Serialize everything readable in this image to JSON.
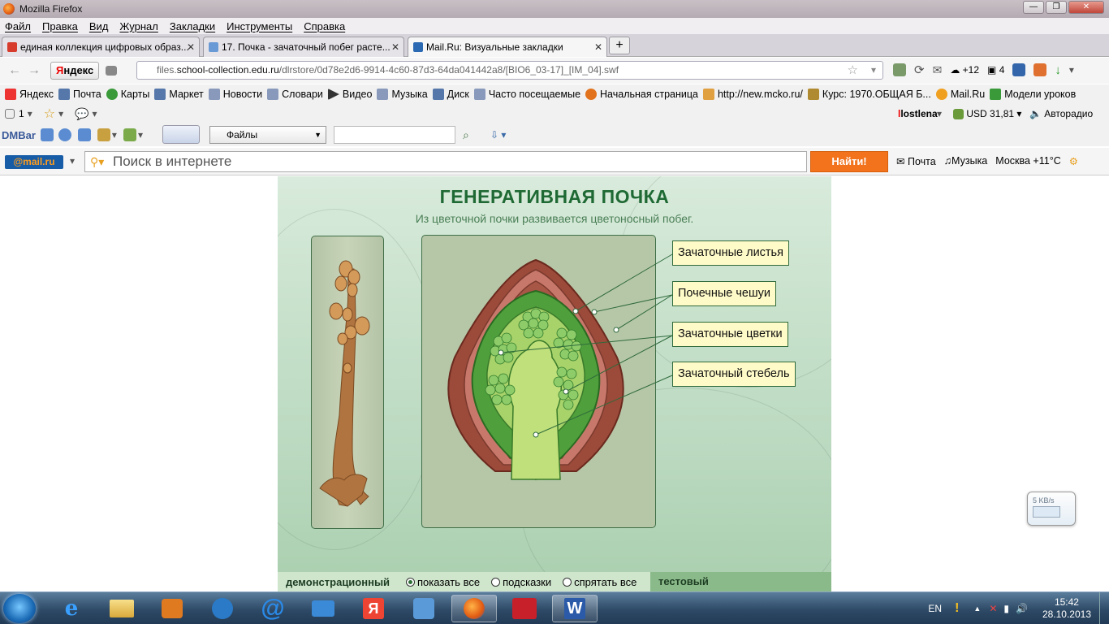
{
  "window": {
    "title": "Mozilla Firefox",
    "buttons": [
      "—",
      "❐",
      "✕"
    ]
  },
  "menu": [
    "Файл",
    "Правка",
    "Вид",
    "Журнал",
    "Закладки",
    "Инструменты",
    "Справка"
  ],
  "tabs": [
    {
      "label": "единая коллекция цифровых образ...",
      "fav_color": "#d63b2b"
    },
    {
      "label": "17. Почка - зачаточный побег расте...",
      "fav_color": "#6a9ad6"
    },
    {
      "label": "Mail.Ru: Визуальные закладки",
      "fav_color": "#2b6ab3"
    }
  ],
  "newtab_label": "+",
  "nav": {
    "yandex_prefix": "Я",
    "yandex_rest": "ндекс",
    "url_host_prefix": "files.",
    "url_host_main": "school-collection.edu.ru",
    "url_path": "/dlrstore/0d78e2d6-9914-4c60-87d3-64da041442a8/[BIO6_03-17]_[IM_04].swf",
    "weather": "+12",
    "mail_count": "4"
  },
  "bookmarks": [
    {
      "label": "Яндекс",
      "color": "#e33"
    },
    {
      "label": "Почта",
      "color": "#5577aa"
    },
    {
      "label": "Карты",
      "color": "#3a9a3a"
    },
    {
      "label": "Маркет",
      "color": "#5577aa"
    },
    {
      "label": "Новости",
      "color": "#8899bb"
    },
    {
      "label": "Словари",
      "color": "#8899bb"
    },
    {
      "label": "Видео",
      "color": "#333"
    },
    {
      "label": "Музыка",
      "color": "#8899bb"
    },
    {
      "label": "Диск",
      "color": "#5577aa"
    },
    {
      "label": "Часто посещаемые",
      "color": "#8899bb"
    },
    {
      "label": "Начальная страница",
      "color": "#e2731c"
    },
    {
      "label": "http://new.mcko.ru/",
      "color": "#e0a040"
    },
    {
      "label": "Курс: 1970.ОБЩАЯ Б...",
      "color": "#b08a30"
    },
    {
      "label": "Mail.Ru",
      "color": "#f0a020"
    },
    {
      "label": "Модели уроков",
      "color": "#3a9a3a"
    }
  ],
  "addon1": {
    "count": "1",
    "user": "lostlena",
    "usd": "USD 31,81",
    "radio": "Авторадио"
  },
  "addon2": {
    "dmbar": "DMBar",
    "files": "Файлы"
  },
  "mailru": {
    "logo_at": "@",
    "logo_rest": "mail.ru",
    "search_placeholder": "Поиск в интернете",
    "find": "Найти!",
    "mail": "Почта",
    "music": "Музыка",
    "weather": "Москва +11°C"
  },
  "content": {
    "title": "ГЕНЕРАТИВНАЯ ПОЧКА",
    "subtitle": "Из цветочной почки развивается цветоносный побег.",
    "labels": [
      "Зачаточные листья",
      "Почечные чешуи",
      "Зачаточные цветки",
      "Зачаточный стебель"
    ],
    "controls": {
      "demo": "демонстрационный",
      "show_all": "показать все",
      "hints": "подсказки",
      "hide_all": "спрятать все",
      "test": "тестовый"
    },
    "selected_option": "показать все"
  },
  "netmeter": "5 KB/s",
  "taskbar": {
    "lang": "EN",
    "time": "15:42",
    "date": "28.10.2013"
  },
  "colors": {
    "title_green": "#1f6a34",
    "find_orange": "#f2731c",
    "label_bg": "#fffbc8"
  }
}
